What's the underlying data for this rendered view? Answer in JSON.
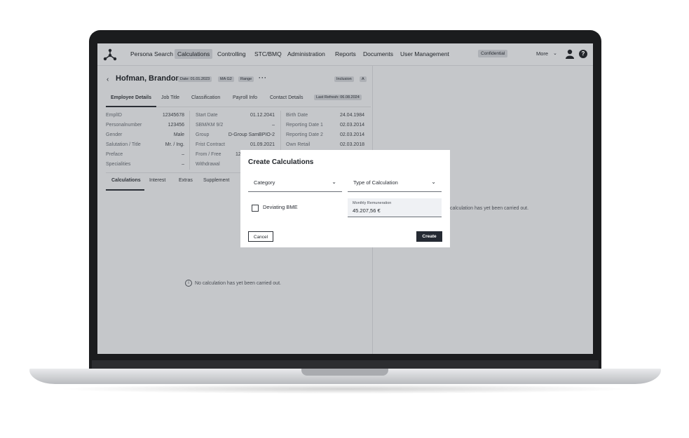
{
  "nav": {
    "items": [
      "Persona Search",
      "Calculations",
      "Controlling",
      "STC/BMQ",
      "Administration",
      "Reports",
      "Documents",
      "User Management"
    ],
    "active": "Calculations",
    "confidential": "Confidential",
    "more": "More"
  },
  "header": {
    "name": "Hofman, Brandon",
    "date": "Date: 01.01.2023",
    "ma": "MA G2",
    "range": "Range",
    "inclusion": "Inclusion",
    "a": "A",
    "last_refresh": "Last Refresh: 06.08.2024"
  },
  "tabs": [
    "Employee Details",
    "Job Title",
    "Classification",
    "Payroll Info",
    "Contact Details"
  ],
  "details": {
    "col1": [
      {
        "label": "EmplID",
        "value": "12345678"
      },
      {
        "label": "Personalnumber",
        "value": "123456"
      },
      {
        "label": "Gender",
        "value": "Male"
      },
      {
        "label": "Salutation / Title",
        "value": "Mr. / Ing."
      },
      {
        "label": "Preface",
        "value": "–"
      },
      {
        "label": "Specialities",
        "value": "–"
      }
    ],
    "col2": [
      {
        "label": "Start Date",
        "value": "01.12.2041"
      },
      {
        "label": "SBM/KM 9/2",
        "value": "–"
      },
      {
        "label": "Group",
        "value": "D-Group SamBPIO-2"
      },
      {
        "label": "Frist Contract",
        "value": "01.09.2021"
      },
      {
        "label": "From / Free",
        "value": "12"
      },
      {
        "label": "Withdrawal",
        "value": ""
      }
    ],
    "col3": [
      {
        "label": "Birth Date",
        "value": "24.04.1984"
      },
      {
        "label": "Reporting Date 1",
        "value": "02.03.2014"
      },
      {
        "label": "Reporting Date 2",
        "value": "02.03.2014"
      },
      {
        "label": "Own Retail",
        "value": "02.03.2018"
      }
    ]
  },
  "subtabs": [
    "Calculations",
    "Interest",
    "Extras",
    "Supplement"
  ],
  "empty_message": "No calculation has yet been carried out.",
  "right_message_partial": "calculation has yet been carried out.",
  "modal": {
    "title": "Create Calculations",
    "category": "Category",
    "type": "Type of Calculation",
    "deviating": "Deviating BME",
    "monthly_label": "Monthly Remuneration",
    "monthly_value": "45.207,56 €",
    "cancel": "Cancel",
    "create": "Create"
  }
}
